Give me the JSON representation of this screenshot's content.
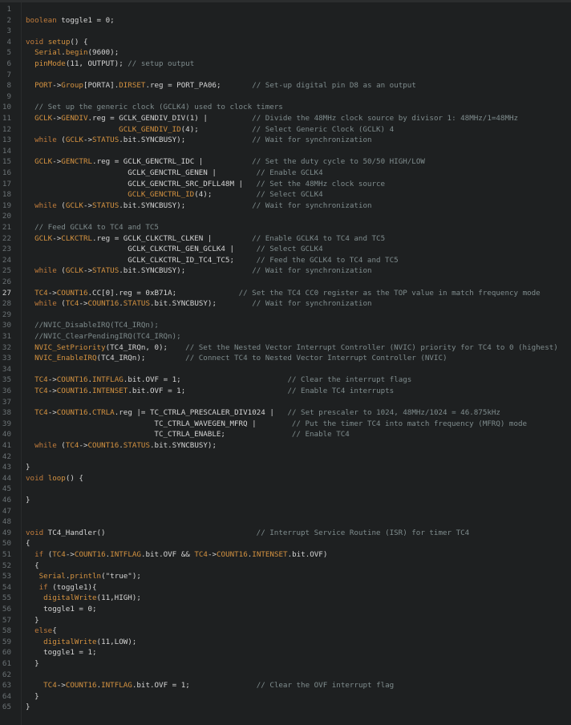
{
  "active_line": 27,
  "lines": [
    "",
    "boolean toggle1 = 0;",
    "",
    "void setup() {",
    "  Serial.begin(9600);",
    "  pinMode(11, OUTPUT); // setup output",
    "",
    "  PORT->Group[PORTA].DIRSET.reg = PORT_PA06;       // Set-up digital pin D8 as an output",
    "",
    "  // Set up the generic clock (GCLK4) used to clock timers",
    "  GCLK->GENDIV.reg = GCLK_GENDIV_DIV(1) |          // Divide the 48MHz clock source by divisor 1: 48MHz/1=48MHz",
    "                     GCLK_GENDIV_ID(4);            // Select Generic Clock (GCLK) 4",
    "  while (GCLK->STATUS.bit.SYNCBUSY);               // Wait for synchronization",
    "",
    "  GCLK->GENCTRL.reg = GCLK_GENCTRL_IDC |           // Set the duty cycle to 50/50 HIGH/LOW",
    "                       GCLK_GENCTRL_GENEN |         // Enable GCLK4",
    "                       GCLK_GENCTRL_SRC_DFLL48M |   // Set the 48MHz clock source",
    "                       GCLK_GENCTRL_ID(4);          // Select GCLK4",
    "  while (GCLK->STATUS.bit.SYNCBUSY);               // Wait for synchronization",
    "",
    "  // Feed GCLK4 to TC4 and TC5",
    "  GCLK->CLKCTRL.reg = GCLK_CLKCTRL_CLKEN |         // Enable GCLK4 to TC4 and TC5",
    "                       GCLK_CLKCTRL_GEN_GCLK4 |     // Select GCLK4",
    "                       GCLK_CLKCTRL_ID_TC4_TC5;     // Feed the GCLK4 to TC4 and TC5",
    "  while (GCLK->STATUS.bit.SYNCBUSY);               // Wait for synchronization",
    "",
    "  TC4->COUNT16.CC[0].reg = 0xB71A;              // Set the TC4 CC0 register as the TOP value in match frequency mode",
    "  while (TC4->COUNT16.STATUS.bit.SYNCBUSY);        // Wait for synchronization",
    "",
    "  //NVIC_DisableIRQ(TC4_IRQn);",
    "  //NVIC_ClearPendingIRQ(TC4_IRQn);",
    "  NVIC_SetPriority(TC4_IRQn, 0);    // Set the Nested Vector Interrupt Controller (NVIC) priority for TC4 to 0 (highest)",
    "  NVIC_EnableIRQ(TC4_IRQn);         // Connect TC4 to Nested Vector Interrupt Controller (NVIC)",
    "",
    "  TC4->COUNT16.INTFLAG.bit.OVF = 1;                        // Clear the interrupt flags",
    "  TC4->COUNT16.INTENSET.bit.OVF = 1;                       // Enable TC4 interrupts",
    "",
    "  TC4->COUNT16.CTRLA.reg |= TC_CTRLA_PRESCALER_DIV1024 |   // Set prescaler to 1024, 48MHz/1024 = 46.875kHz",
    "                             TC_CTRLA_WAVEGEN_MFRQ |        // Put the timer TC4 into match frequency (MFRQ) mode",
    "                             TC_CTRLA_ENABLE;               // Enable TC4",
    "  while (TC4->COUNT16.STATUS.bit.SYNCBUSY);",
    "",
    "}",
    "void loop() {",
    "",
    "}",
    "",
    "",
    "void TC4_Handler()                                  // Interrupt Service Routine (ISR) for timer TC4",
    "{",
    "  if (TC4->COUNT16.INTFLAG.bit.OVF && TC4->COUNT16.INTENSET.bit.OVF)",
    "  {",
    "   Serial.println(\"true\");",
    "   if (toggle1){",
    "    digitalWrite(11,HIGH);",
    "    toggle1 = 0;",
    "  }",
    "  else{",
    "    digitalWrite(11,LOW);",
    "    toggle1 = 1;",
    "  }",
    "",
    "    TC4->COUNT16.INTFLAG.bit.OVF = 1;               // Clear the OVF interrupt flag",
    "  }",
    "}"
  ]
}
